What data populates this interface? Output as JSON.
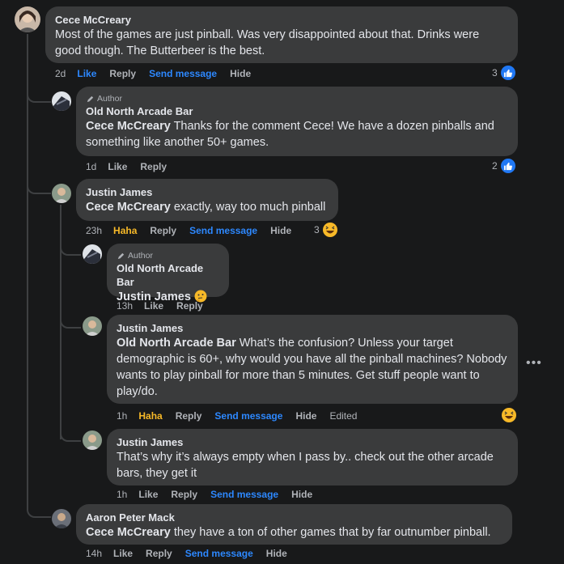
{
  "colors": {
    "background": "#18191a",
    "bubble": "#3a3b3c",
    "link": "#2d88ff",
    "haha": "#f7b928",
    "like": "#2078f4"
  },
  "comments": [
    {
      "name": "Cece McCreary",
      "text": "Most of the games are just pinball. Was very disappointed about that. Drinks were good though. The Butterbeer is the best.",
      "actions": {
        "time": "2d",
        "like": "Like",
        "reply": "Reply",
        "send": "Send message",
        "hide": "Hide"
      },
      "reaction": {
        "count": "3",
        "icon": "like-icon"
      }
    },
    {
      "badge": "Author",
      "name": "Old North Arcade Bar",
      "tag": "Cece McCreary",
      "text": " Thanks for the comment Cece! We have a dozen pinballs and something like another 50+ games.",
      "actions": {
        "time": "1d",
        "like": "Like",
        "reply": "Reply"
      },
      "reaction": {
        "count": "2",
        "icon": "like-icon"
      }
    },
    {
      "name": "Justin James",
      "tag": "Cece McCreary",
      "text": " exactly, way too much pinball",
      "actions": {
        "time": "23h",
        "like": "Haha",
        "reply": "Reply",
        "send": "Send message",
        "hide": "Hide"
      },
      "reaction": {
        "count": "3",
        "icon": "haha-icon"
      }
    },
    {
      "badge": "Author",
      "name": "Old North Arcade Bar",
      "tag": "Justin James",
      "emoji": "thinking-face-emoji",
      "actions": {
        "time": "13h",
        "like": "Like",
        "reply": "Reply"
      }
    },
    {
      "name": "Justin James",
      "tag": "Old North Arcade Bar",
      "text": " What’s the confusion? Unless your target demographic is 60+, why would you have all the pinball machines? Nobody wants to play pinball for more than 5 minutes. Get stuff people want to play/do.",
      "actions": {
        "time": "1h",
        "like": "Haha",
        "reply": "Reply",
        "send": "Send message",
        "hide": "Hide",
        "edited": "Edited"
      },
      "reaction": {
        "icon": "haha-icon"
      }
    },
    {
      "name": "Justin James",
      "text": "That’s why it’s always empty when I pass by.. check out the other arcade bars, they get it",
      "actions": {
        "time": "1h",
        "like": "Like",
        "reply": "Reply",
        "send": "Send message",
        "hide": "Hide"
      }
    },
    {
      "name": "Aaron Peter Mack",
      "tag": "Cece McCreary",
      "text": " they have a ton of other games that by far outnumber pinball.",
      "actions": {
        "time": "14h",
        "like": "Like",
        "reply": "Reply",
        "send": "Send message",
        "hide": "Hide"
      }
    }
  ],
  "more_icon": "more-options-icon"
}
